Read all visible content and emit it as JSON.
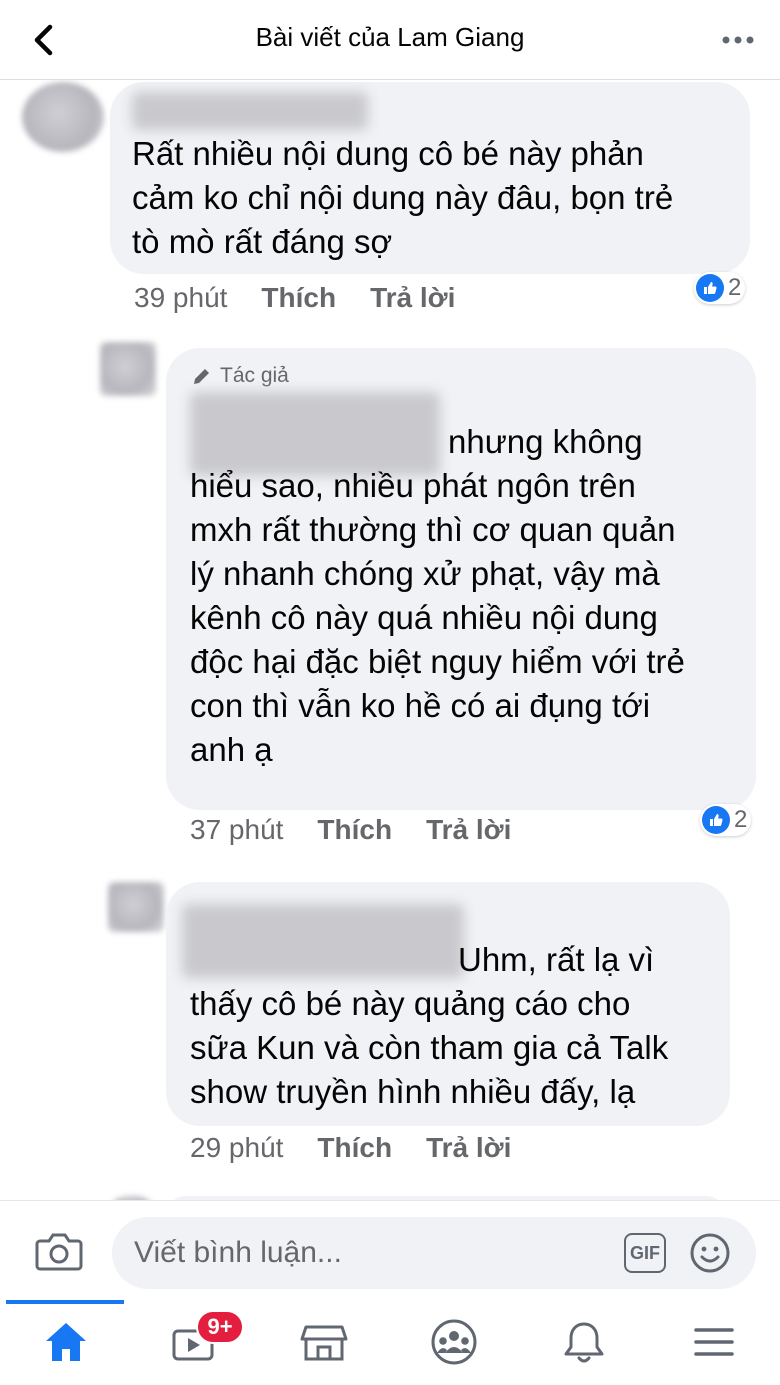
{
  "header": {
    "title": "Bài viết của Lam Giang",
    "back_icon": "chevron-left-icon",
    "more_icon": "more-horizontal-icon"
  },
  "comments": [
    {
      "lines": [
        "Rất nhiều nội dung cô bé này phản",
        "cảm ko chỉ nội dung này đâu, bọn trẻ",
        "tò mò rất đáng sợ"
      ],
      "time": "39 phút",
      "like_label": "Thích",
      "reply_label": "Trả lời",
      "reaction_count": "2"
    },
    {
      "author_badge": "Tác giả",
      "lines": [
        "nhưng không",
        "hiểu sao, nhiều phát ngôn trên",
        "mxh rất thường thì cơ quan quản",
        "lý nhanh chóng xử phạt, vậy mà",
        "kênh cô này quá nhiều nội dung",
        "độc hại đặc biệt nguy hiểm với trẻ",
        "con thì vẫn ko hề có ai đụng tới",
        "anh ạ"
      ],
      "time": "37 phút",
      "like_label": "Thích",
      "reply_label": "Trả lời",
      "reaction_count": "2"
    },
    {
      "lines": [
        "Uhm, rất lạ vì",
        "thấy cô bé này quảng cáo cho",
        "sữa Kun và còn tham gia cả Talk",
        "show truyền hình nhiều đấy, lạ"
      ],
      "time": "29 phút",
      "like_label": "Thích",
      "reply_label": "Trả lời"
    }
  ],
  "composer": {
    "placeholder": "Viết bình luận...",
    "gif_label": "GIF",
    "camera_icon": "camera-icon",
    "emoji_icon": "emoji-icon"
  },
  "bottom_nav": {
    "items": [
      "home-icon",
      "video-icon",
      "marketplace-icon",
      "groups-icon",
      "bell-icon",
      "menu-icon"
    ],
    "video_badge": "9+"
  },
  "colors": {
    "accent": "#1877f2",
    "bubble": "#f0f2f5",
    "badge": "#e41e3f",
    "secondary_text": "#65676b"
  }
}
